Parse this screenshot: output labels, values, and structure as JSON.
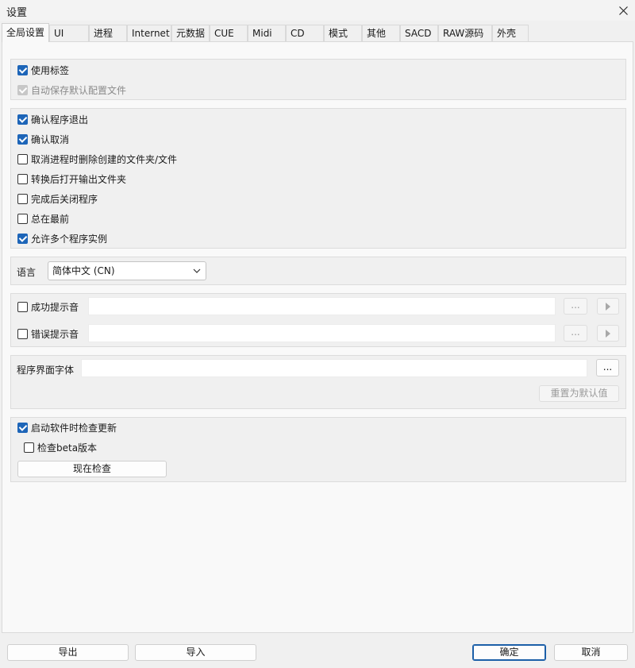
{
  "window": {
    "title": "设置",
    "close_icon": "close-icon"
  },
  "tabs": [
    {
      "label": "全局设置",
      "active": true
    },
    {
      "label": "UI"
    },
    {
      "label": "进程"
    },
    {
      "label": "Internet"
    },
    {
      "label": "元数据"
    },
    {
      "label": "CUE"
    },
    {
      "label": "Midi"
    },
    {
      "label": "CD"
    },
    {
      "label": "模式"
    },
    {
      "label": "其他"
    },
    {
      "label": "SACD"
    },
    {
      "label": "RAW源码"
    },
    {
      "label": "外壳"
    }
  ],
  "group1": {
    "use_tags": {
      "label": "使用标签",
      "checked": true
    },
    "autosave_default": {
      "label": "自动保存默认配置文件",
      "checked": true,
      "disabled": true
    }
  },
  "group2": {
    "items": [
      {
        "label": "确认程序退出",
        "checked": true
      },
      {
        "label": "确认取消",
        "checked": true
      },
      {
        "label": "取消进程时删除创建的文件夹/文件",
        "checked": false
      },
      {
        "label": "转换后打开输出文件夹",
        "checked": false
      },
      {
        "label": "完成后关闭程序",
        "checked": false
      },
      {
        "label": "总在最前",
        "checked": false
      },
      {
        "label": "允许多个程序实例",
        "checked": true
      }
    ]
  },
  "language": {
    "label": "语言",
    "selected": "简体中文 (CN)"
  },
  "sounds": {
    "success": {
      "label": "成功提示音",
      "checked": false,
      "value": "",
      "browse": "...",
      "play_icon": "play-icon"
    },
    "error": {
      "label": "错误提示音",
      "checked": false,
      "value": "",
      "browse": "...",
      "play_icon": "play-icon"
    }
  },
  "font": {
    "label": "程序界面字体",
    "value": "",
    "browse": "...",
    "reset": "重置为默认值"
  },
  "updates": {
    "check_on_start": {
      "label": "启动软件时检查更新",
      "checked": true
    },
    "check_beta": {
      "label": "检查beta版本",
      "checked": false
    },
    "check_now": "现在检查"
  },
  "footer": {
    "export": "导出",
    "import": "导入",
    "ok": "确定",
    "cancel": "取消"
  }
}
